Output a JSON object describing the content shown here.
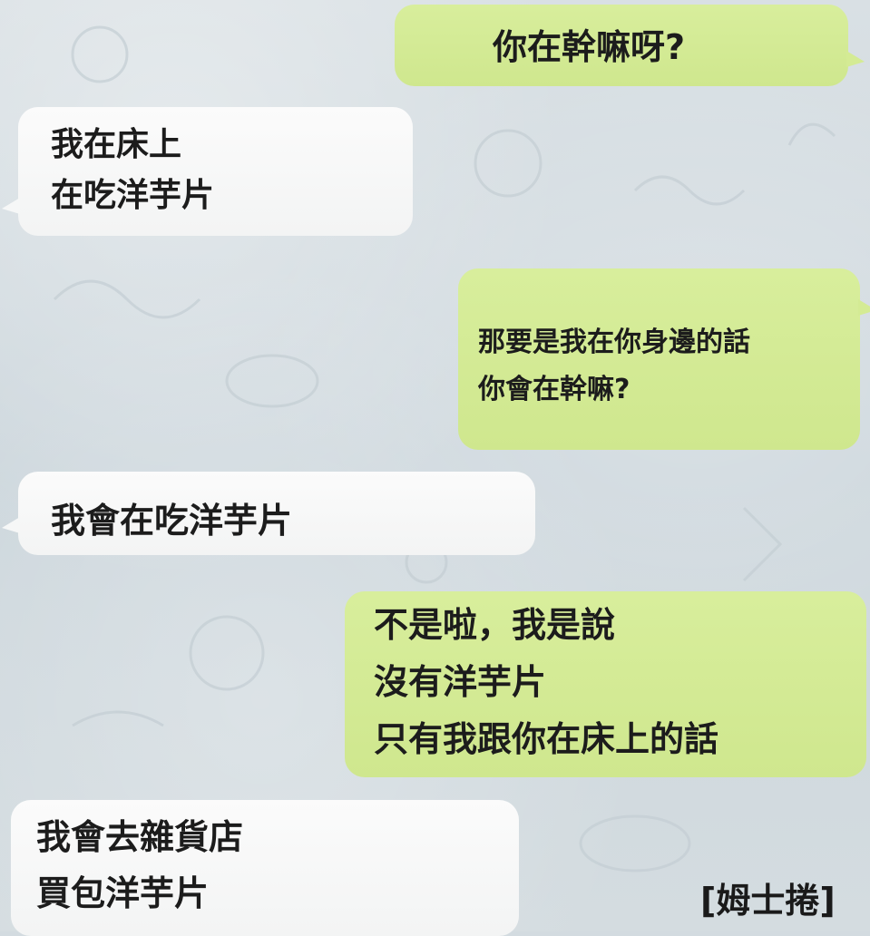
{
  "messages": [
    {
      "side": "outgoing",
      "lines": [
        "你在幹嘛呀?"
      ]
    },
    {
      "side": "incoming",
      "lines": [
        "我在床上",
        "在吃洋芋片"
      ]
    },
    {
      "side": "outgoing",
      "lines": [
        "那要是我在你身邊的話",
        "你會在幹嘛?"
      ]
    },
    {
      "side": "incoming",
      "lines": [
        "我會在吃洋芋片"
      ]
    },
    {
      "side": "outgoing",
      "lines": [
        "不是啦，我是說",
        "沒有洋芋片",
        "只有我跟你在床上的話"
      ]
    },
    {
      "side": "incoming",
      "lines": [
        "我會去雜貨店",
        "買包洋芋片"
      ]
    }
  ],
  "watermark": "[姆士捲]",
  "colors": {
    "outgoing_bubble": "#d4eb94",
    "incoming_bubble": "#f6f7f7",
    "background": "#d3dbe0",
    "text": "#1c1c1c"
  }
}
